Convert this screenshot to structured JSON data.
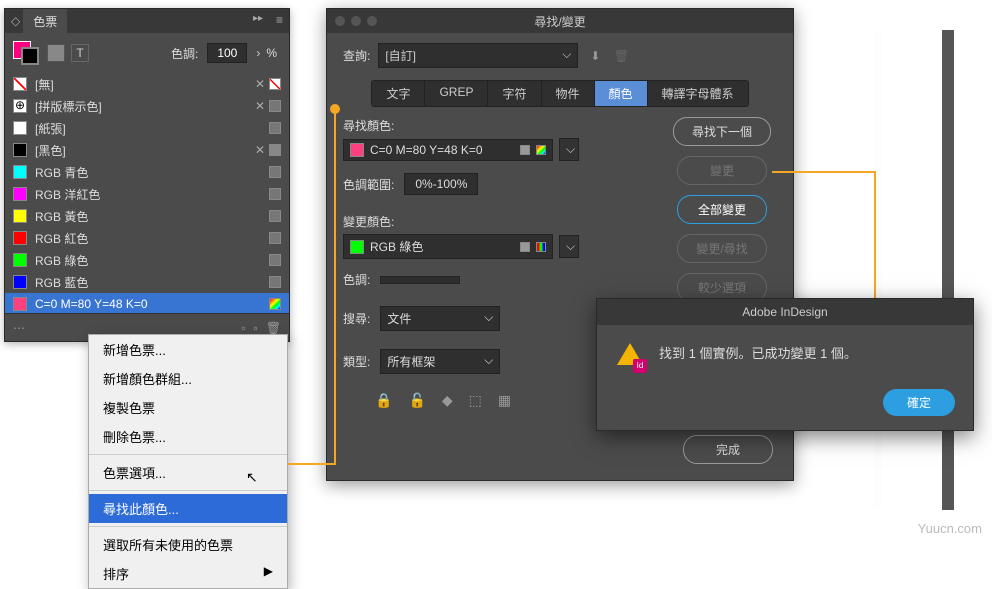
{
  "swatches_panel": {
    "title": "色票",
    "tint_label": "色調:",
    "tint_value": "100",
    "tint_unit": "%",
    "items": [
      {
        "name": "[無]",
        "color": "none",
        "locked": true,
        "none": true
      },
      {
        "name": "[拼版標示色]",
        "color": "reg",
        "locked": true
      },
      {
        "name": "[紙張]",
        "color": "#ffffff",
        "locked": false
      },
      {
        "name": "[黑色]",
        "color": "#000000",
        "locked": true,
        "cmyk": true
      },
      {
        "name": "RGB 青色",
        "color": "#00ffff"
      },
      {
        "name": "RGB 洋紅色",
        "color": "#ff00ff"
      },
      {
        "name": "RGB 黃色",
        "color": "#ffff00"
      },
      {
        "name": "RGB 紅色",
        "color": "#ff0000"
      },
      {
        "name": "RGB 綠色",
        "color": "#00ff00"
      },
      {
        "name": "RGB 藍色",
        "color": "#0000ff"
      },
      {
        "name": "C=0 M=80 Y=48 K=0",
        "color": "#ff4080",
        "selected": true,
        "rainbow": true
      }
    ]
  },
  "context_menu": {
    "items": [
      {
        "label": "新增色票...",
        "enabled": true
      },
      {
        "label": "新增顏色群組...",
        "enabled": true
      },
      {
        "label": "複製色票",
        "enabled": true
      },
      {
        "label": "刪除色票...",
        "enabled": true
      },
      {
        "sep": true
      },
      {
        "label": "色票選項...",
        "enabled": true
      },
      {
        "sep": true
      },
      {
        "label": "尋找此顏色...",
        "enabled": true,
        "highlighted": true
      },
      {
        "sep": true
      },
      {
        "label": "選取所有未使用的色票",
        "enabled": true
      },
      {
        "label": "排序",
        "enabled": true,
        "submenu": true
      }
    ]
  },
  "find_dialog": {
    "title": "尋找/變更",
    "query_label": "查詢:",
    "query_value": "[自訂]",
    "tabs": [
      "文字",
      "GREP",
      "字符",
      "物件",
      "顏色",
      "轉譯字母體系"
    ],
    "active_tab": "顏色",
    "find_color_label": "尋找顏色:",
    "find_color_value": "C=0 M=80 Y=48 K=0",
    "find_color_chip": "#ff4080",
    "tint_range_label": "色調範圍:",
    "tint_range_value": "0%-100%",
    "change_color_label": "變更顏色:",
    "change_color_value": "RGB 綠色",
    "change_color_chip": "#00ff00",
    "tint_label": "色調:",
    "search_label": "搜尋:",
    "search_value": "文件",
    "type_label": "類型:",
    "type_value": "所有框架",
    "buttons": {
      "find_next": "尋找下一個",
      "change": "變更",
      "change_all": "全部變更",
      "change_find": "變更/尋找",
      "fewer_options": "較少選項",
      "done": "完成"
    }
  },
  "alert": {
    "title": "Adobe InDesign",
    "message": "找到 1 個實例。已成功變更 1 個。",
    "ok": "確定",
    "id_badge": "Id"
  },
  "watermark": "Yuucn.com"
}
